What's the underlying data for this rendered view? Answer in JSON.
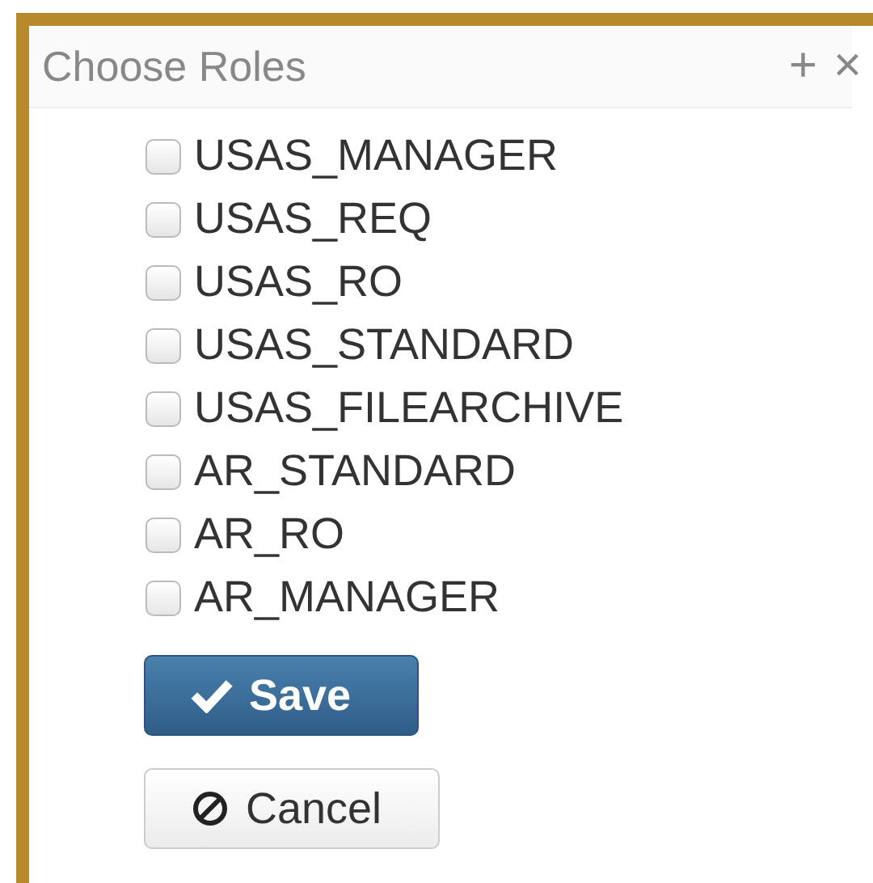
{
  "dialog": {
    "title": "Choose Roles",
    "add_symbol": "+",
    "close_symbol": "×"
  },
  "roles": [
    {
      "label": "USAS_MANAGER",
      "checked": false
    },
    {
      "label": "USAS_REQ",
      "checked": false
    },
    {
      "label": "USAS_RO",
      "checked": false
    },
    {
      "label": "USAS_STANDARD",
      "checked": false
    },
    {
      "label": "USAS_FILEARCHIVE",
      "checked": false
    },
    {
      "label": "AR_STANDARD",
      "checked": false
    },
    {
      "label": "AR_RO",
      "checked": false
    },
    {
      "label": "AR_MANAGER",
      "checked": false
    }
  ],
  "buttons": [
    {
      "kind": "primary",
      "label": "Save"
    },
    {
      "kind": "default",
      "label": "Cancel"
    }
  ]
}
